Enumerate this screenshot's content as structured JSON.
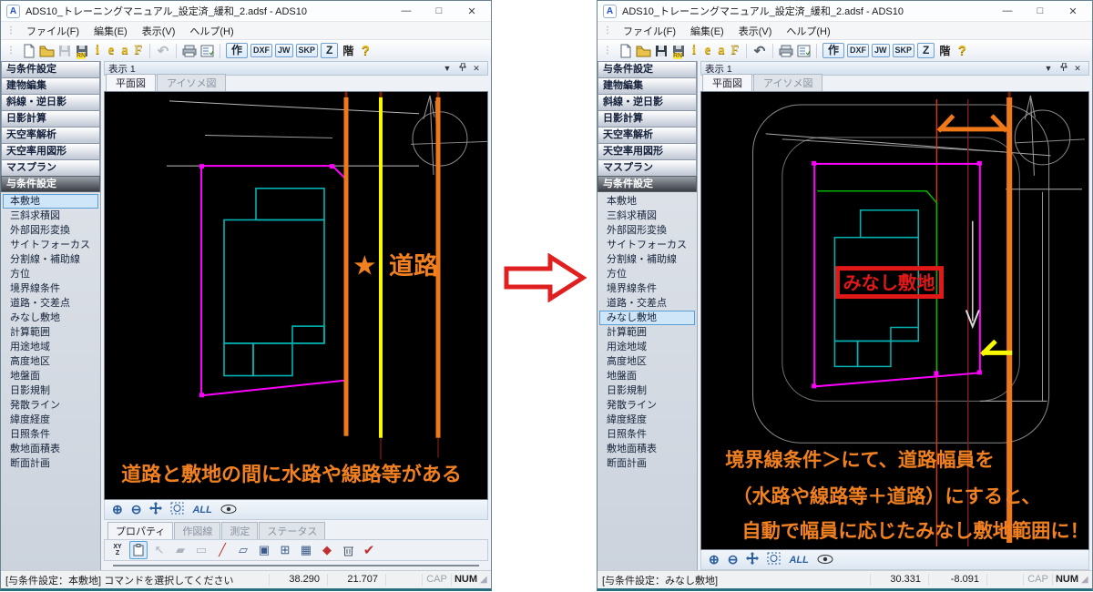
{
  "shared": {
    "window_title": "ADS10_トレーニングマニュアル_設定済_緩和_2.adsf - ADS10",
    "app_initial": "A",
    "menu_items": [
      "ファイル(F)",
      "編集(E)",
      "表示(V)",
      "ヘルプ(H)"
    ],
    "window_controls": {
      "minimize": "—",
      "maximize": "□",
      "close": "✕"
    },
    "toolbar": {
      "letter_i": "i",
      "letter_e": "e",
      "letter_a": "a",
      "letter_f": "F",
      "rn": "RN",
      "undo": "↶",
      "btn_saku": "作",
      "btn_dxf": "DXF",
      "btn_jw": "JW",
      "btn_skp": "SKP",
      "btn_z": "Z",
      "btn_kai": "階",
      "btn_help": "?"
    },
    "view": {
      "title": "表示 1",
      "tabs": [
        "平面図",
        "アイソメ図"
      ],
      "active_tab": "平面図",
      "collapse": "▼",
      "close": "✕",
      "zoom_in": "⊕",
      "zoom_out": "⊖",
      "zoom_all": "ALL"
    },
    "sidebar": {
      "modules": [
        "与条件設定",
        "建物編集",
        "斜線・逆日影",
        "日影計算",
        "天空率解析",
        "天空率用図形",
        "マスプラン"
      ],
      "section_header": "与条件設定",
      "items": [
        "本敷地",
        "三斜求積図",
        "外部図形変換",
        "サイトフォーカス",
        "分割線・補助線",
        "方位",
        "境界線条件",
        "道路・交差点",
        "みなし敷地",
        "計算範囲",
        "用途地域",
        "高度地区",
        "地盤面",
        "日影規制",
        "発散ライン",
        "緯度経度",
        "日照条件",
        "敷地面積表",
        "断面計画"
      ]
    },
    "status": {
      "cap": "CAP",
      "num": "NUM"
    },
    "colors": {
      "accent_orange": "#f07818",
      "magenta": "#ff00ff",
      "cyan": "#00b4b4",
      "yellow": "#f8f800",
      "green": "#00b400",
      "red_label": "#e01818"
    }
  },
  "left": {
    "sidebar_selected": "本敷地",
    "panel_tabs": [
      "プロパティ",
      "作図線",
      "測定",
      "ステータス"
    ],
    "panel_active_tab": "プロパティ",
    "panel_xyz_icon": {
      "top": "XY",
      "bottom": "Z"
    },
    "canvas": {
      "star": "★",
      "road_label": "道路",
      "caption": "道路と敷地の間に水路や線路等がある"
    },
    "status_label": "[与条件設定：本敷地]",
    "status_message": "コマンドを選択してください",
    "coord_x": "38.290",
    "coord_y": "21.707"
  },
  "right": {
    "sidebar_selected": "みなし敷地",
    "canvas": {
      "minashi_label": "みなし敷地",
      "caption_lines": [
        "境界線条件＞にて、道路幅員を",
        "（水路や線路等＋道路）にすると、",
        "自動で幅員に応じたみなし敷地範囲に！"
      ]
    },
    "status_label": "[与条件設定：みなし敷地]",
    "status_message": "",
    "coord_x": "30.331",
    "coord_y": "-8.091"
  }
}
